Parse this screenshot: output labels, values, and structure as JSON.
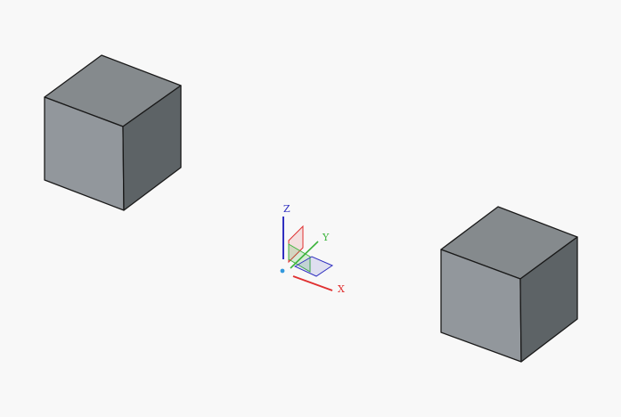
{
  "viewport": {
    "background": "#f8f8f8",
    "objects": [
      {
        "name": "cube-left",
        "shape": "box"
      },
      {
        "name": "cube-right",
        "shape": "box"
      }
    ],
    "cube_colors": {
      "top": "#858a8d",
      "left": "#92979c",
      "right": "#5d6366",
      "edge": "#1a1a1a"
    }
  },
  "triad": {
    "x_label": "X",
    "y_label": "Y",
    "z_label": "Z",
    "x_color": "#e03030",
    "y_color": "#3cb43c",
    "z_color": "#3030c0",
    "origin_color": "#3399dd"
  }
}
